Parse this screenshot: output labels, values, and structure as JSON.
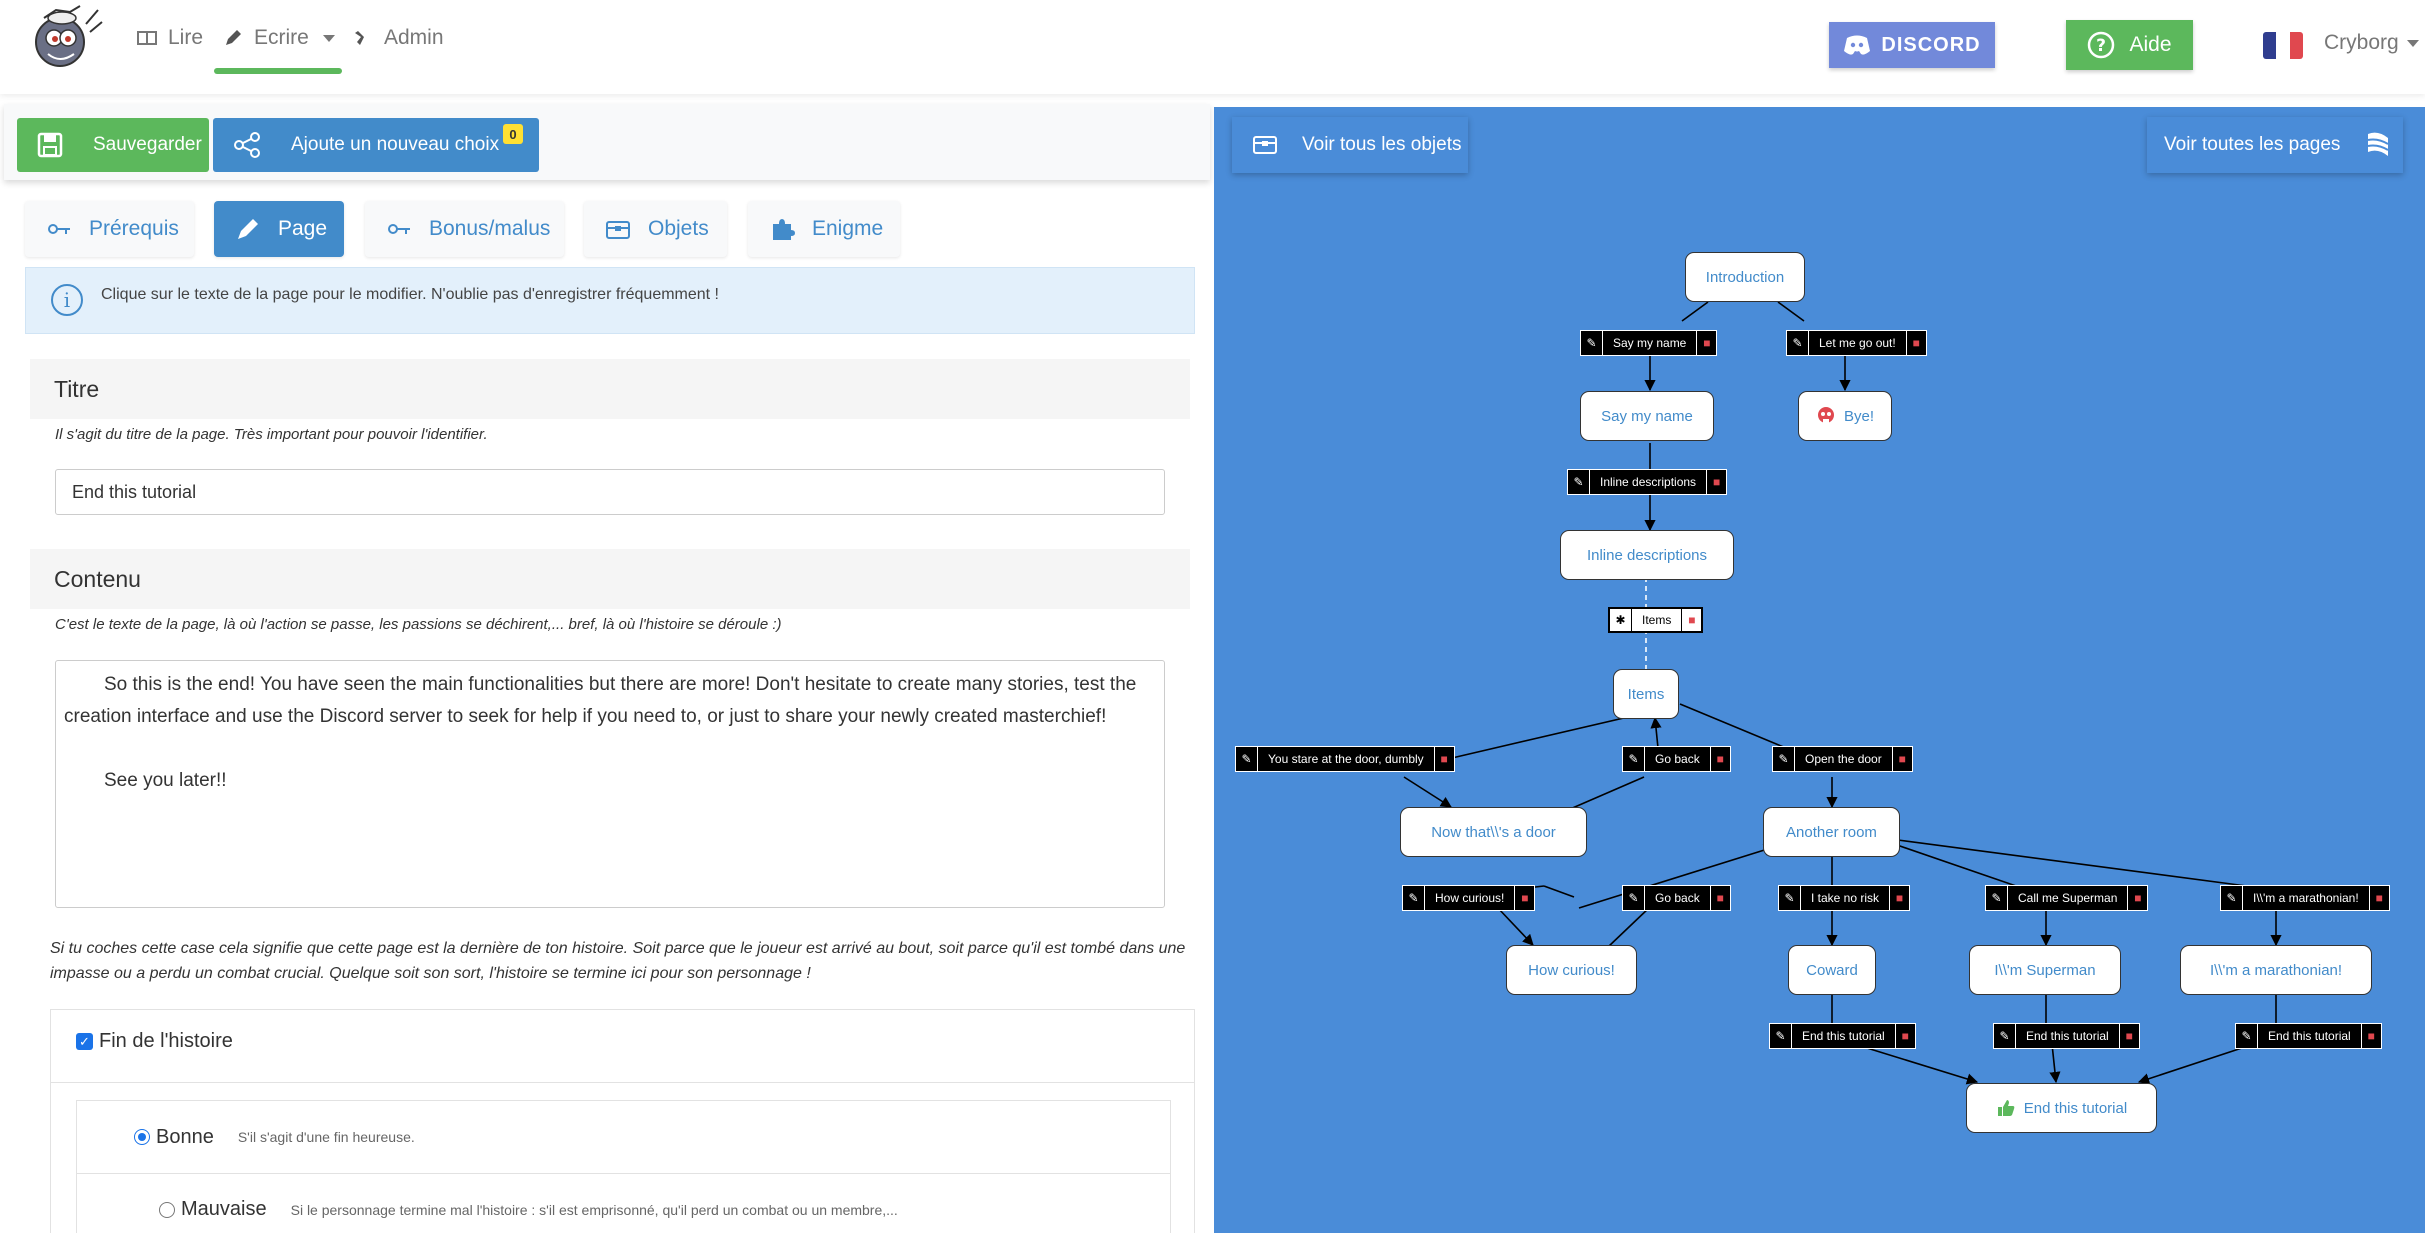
{
  "nav": {
    "lire": "Lire",
    "ecrire": "Ecrire",
    "admin": "Admin",
    "discord": "DISCORD",
    "aide": "Aide",
    "user": "Cryborg"
  },
  "toolbar": {
    "save": "Sauvegarder",
    "add_choice": "Ajoute un nouveau choix",
    "choice_count": "0"
  },
  "tabs": [
    {
      "label": "Prérequis",
      "icon": "key-icon"
    },
    {
      "label": "Page",
      "icon": "pen-icon",
      "active": true
    },
    {
      "label": "Bonus/malus",
      "icon": "key-icon"
    },
    {
      "label": "Objets",
      "icon": "chest-icon"
    },
    {
      "label": "Enigme",
      "icon": "puzzle-icon"
    }
  ],
  "info": "Clique sur le texte de la page pour le modifier. N'oublie pas d'enregistrer fréquemment !",
  "title_section": {
    "heading": "Titre",
    "help": "Il s'agit du titre de la page. Très important pour pouvoir l'identifier.",
    "value": "End this tutorial"
  },
  "content_section": {
    "heading": "Contenu",
    "help": "C'est le texte de la page, là où l'action se passe, les passions se déchirent,... bref, là où l'histoire se déroule :)",
    "paragraph1": "So this is the end! You have seen the main functionalities but there are more! Don't hesitate to create many stories, test the creation interface and use the Discord server to seek for help if you need to, or just to share your newly created masterchief!",
    "paragraph2": "See you later!!"
  },
  "end_section": {
    "help": "Si tu coches cette case cela signifie que cette page est la dernière de ton histoire. Soit parce que le joueur est arrivé au bout, soit parce qu'il est tombé dans une impasse ou a perdu un combat crucial. Quelque soit son sort, l'histoire se termine ici pour son personnage !",
    "checkbox_label": "Fin de l'histoire",
    "options": [
      {
        "label": "Bonne",
        "desc": "S'il s'agit d'une fin heureuse.",
        "selected": true
      },
      {
        "label": "Mauvaise",
        "desc": "Si le personnage termine mal l'histoire : s'il est emprisonné, qu'il perd un combat ou un membre,...",
        "selected": false
      }
    ]
  },
  "graph": {
    "view_objects": "Voir tous les objets",
    "view_pages": "Voir toutes les pages",
    "nodes": {
      "introduction": "Introduction",
      "say_my_name": "Say my name",
      "bye": "Bye!",
      "inline_descriptions": "Inline descriptions",
      "items": "Items",
      "now_door": "Now that\\\\'s a door",
      "another_room": "Another room",
      "how_curious": "How curious!",
      "coward": "Coward",
      "superman": "I\\\\'m Superman",
      "marathonian": "I\\\\'m a marathonian!",
      "end": "End this tutorial"
    },
    "edges": {
      "say_my_name": "Say my name",
      "let_me_go": "Let me go out!",
      "inline_descriptions": "Inline descriptions",
      "items": "Items",
      "stare_door": "You stare at the door, dumbly",
      "go_back_1": "Go back",
      "open_door": "Open the door",
      "how_curious": "How curious!",
      "go_back_2": "Go back",
      "no_risk": "I take no risk",
      "call_superman": "Call me Superman",
      "marathonian": "I\\\\'m a marathonian!",
      "end_1": "End this tutorial",
      "end_2": "End this tutorial",
      "end_3": "End this tutorial"
    }
  },
  "colors": {
    "green": "#5cb85c",
    "blue": "#428bca",
    "graph_bg": "#4a8cd8",
    "discord": "#7289da"
  }
}
